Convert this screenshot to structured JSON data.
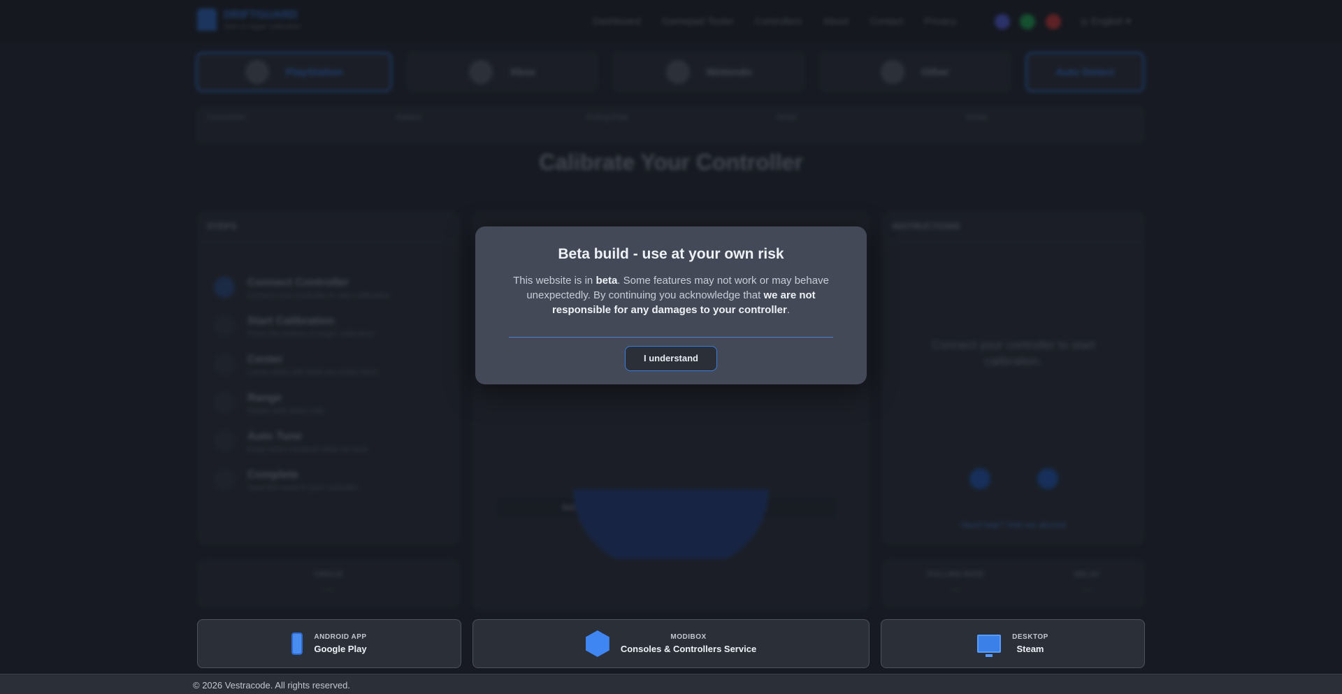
{
  "app": {
    "logo_title": "DRIFTGUARD",
    "logo_subtitle": "Stick & trigger calibration"
  },
  "nav": {
    "items": [
      "Dashboard",
      "Gamepad Tester",
      "Controllers",
      "About",
      "Contact",
      "Privacy"
    ],
    "language": "English"
  },
  "platforms": [
    {
      "label": "PlayStation"
    },
    {
      "label": "Xbox"
    },
    {
      "label": "Nintendo"
    },
    {
      "label": "Other"
    },
    {
      "label": "Auto Detect"
    }
  ],
  "stats": [
    {
      "label": "Connection"
    },
    {
      "label": "Battery"
    },
    {
      "label": "Polling Rate"
    },
    {
      "label": "Serial"
    },
    {
      "label": "Model"
    }
  ],
  "heading": "Calibrate Your Controller",
  "steps_card": {
    "title": "STEPS",
    "steps": [
      {
        "title": "Connect Controller",
        "sub": "Connect your controller to start calibration"
      },
      {
        "title": "Start Calibration",
        "sub": "Press the buttons to begin calibration"
      },
      {
        "title": "Center",
        "sub": "Leave sticks still while we center them"
      },
      {
        "title": "Range",
        "sub": "Rotate both sticks fully"
      },
      {
        "title": "Auto Tune",
        "sub": "Keep sticks centered while we tune"
      },
      {
        "title": "Complete",
        "sub": "Save the result to your controller"
      }
    ]
  },
  "instructions_card": {
    "title": "INSTRUCTIONS",
    "text": "Connect your controller to start calibration.",
    "help": "Need help? Visit our discord"
  },
  "center_buttons": {
    "settings": "Settings",
    "reset": "Reset"
  },
  "metrics": {
    "circle": "CIRCLE",
    "circle_val": "—",
    "polling": "POLLING RATE",
    "polling_val": "—",
    "delay": "DELAY",
    "delay_val": "—"
  },
  "modal": {
    "title": "Beta build - use at your own risk",
    "body_1": "This website is in ",
    "body_bold_1": "beta",
    "body_2": ". Some features may not work or may behave unexpectedly. By continuing you acknowledge that ",
    "body_bold_2": "we are not responsible for any damages to your controller",
    "body_3": ".",
    "button": "I understand"
  },
  "footer_cards": [
    {
      "small": "ANDROID APP",
      "big": "Google Play",
      "icon": "phone-icon"
    },
    {
      "small": "MODIBOX",
      "big": "Consoles & Controllers Service",
      "icon": "cube-icon"
    },
    {
      "small": "DESKTOP",
      "big": "Steam",
      "icon": "monitor-icon"
    }
  ],
  "copyright": "© 2026 Vestracode. All rights reserved."
}
